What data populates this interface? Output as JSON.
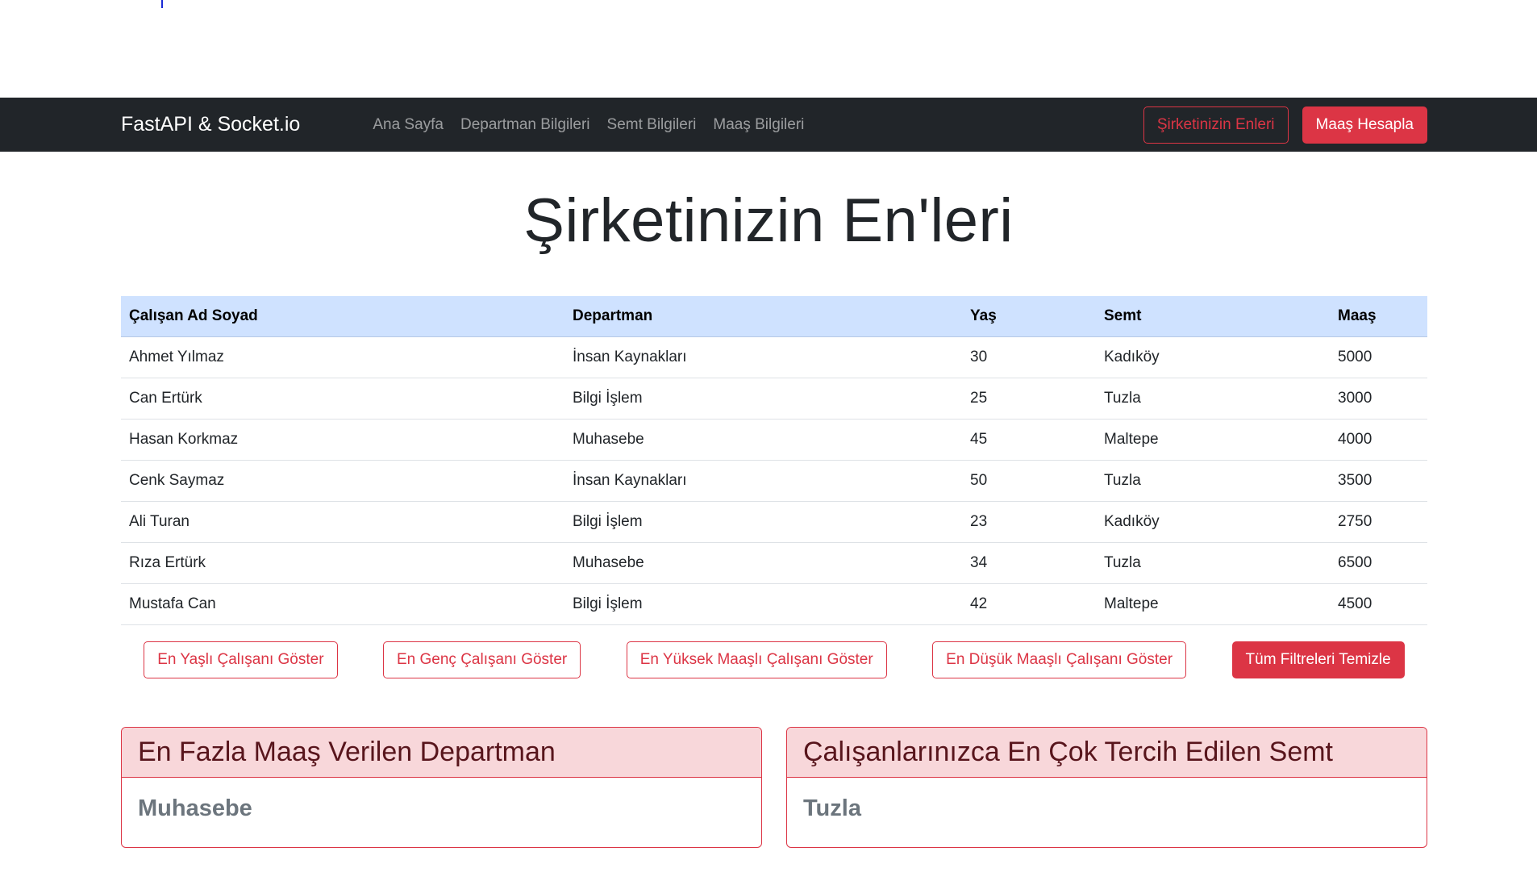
{
  "navbar": {
    "brand": "FastAPI & Socket.io",
    "links": [
      "Ana Sayfa",
      "Departman Bilgileri",
      "Semt Bilgileri",
      "Maaş Bilgileri"
    ],
    "actions": {
      "outline_button": "Şirketinizin Enleri",
      "solid_button": "Maaş Hesapla"
    }
  },
  "page": {
    "title": "Şirketinizin En'leri"
  },
  "table": {
    "headers": [
      "Çalışan Ad Soyad",
      "Departman",
      "Yaş",
      "Semt",
      "Maaş"
    ],
    "rows": [
      [
        "Ahmet Yılmaz",
        "İnsan Kaynakları",
        "30",
        "Kadıköy",
        "5000"
      ],
      [
        "Can Ertürk",
        "Bilgi İşlem",
        "25",
        "Tuzla",
        "3000"
      ],
      [
        "Hasan Korkmaz",
        "Muhasebe",
        "45",
        "Maltepe",
        "4000"
      ],
      [
        "Cenk Saymaz",
        "İnsan Kaynakları",
        "50",
        "Tuzla",
        "3500"
      ],
      [
        "Ali Turan",
        "Bilgi İşlem",
        "23",
        "Kadıköy",
        "2750"
      ],
      [
        "Rıza Ertürk",
        "Muhasebe",
        "34",
        "Tuzla",
        "6500"
      ],
      [
        "Mustafa Can",
        "Bilgi İşlem",
        "42",
        "Maltepe",
        "4500"
      ]
    ]
  },
  "filters": {
    "oldest": "En Yaşlı Çalışanı Göster",
    "youngest": "En Genç Çalışanı Göster",
    "highest_salary": "En Yüksek Maaşlı Çalışanı Göster",
    "lowest_salary": "En Düşük Maaşlı Çalışanı Göster",
    "clear": "Tüm Filtreleri Temizle"
  },
  "cards": {
    "top_department": {
      "header": "En Fazla Maaş Verilen Departman",
      "value": "Muhasebe"
    },
    "top_district": {
      "header": "Çalışanlarınızca En Çok Tercih Edilen Semt",
      "value": "Tuzla"
    }
  },
  "colors": {
    "navbar_bg": "#212529",
    "danger": "#dc3545",
    "table_header_bg": "#cfe2ff",
    "card_header_bg": "#f8d7da"
  }
}
